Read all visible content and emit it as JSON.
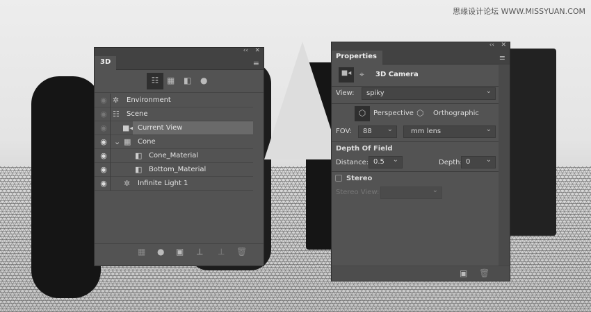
{
  "watermark": "思缘设计论坛 WWW.MISSYUAN.COM",
  "panel3d": {
    "tab": "3D",
    "collapse": "‹‹",
    "close": "✕",
    "layers": [
      {
        "label": "Environment",
        "icon": "environment-icon",
        "visible": false
      },
      {
        "label": "Scene",
        "icon": "scene-icon",
        "visible": false
      },
      {
        "label": "Current View",
        "icon": "camera-icon",
        "visible": false,
        "selected": true
      },
      {
        "label": "Cone",
        "icon": "mesh-icon",
        "visible": true,
        "expanded": true
      },
      {
        "label": "Cone_Material",
        "icon": "material-icon",
        "visible": true
      },
      {
        "label": "Bottom_Material",
        "icon": "material-icon",
        "visible": true
      },
      {
        "label": "Infinite Light 1",
        "icon": "light-icon",
        "visible": true
      }
    ]
  },
  "properties": {
    "tab": "Properties",
    "title": "3D Camera",
    "view_label": "View:",
    "view_value": "spiky",
    "perspective": "Perspective",
    "orthographic": "Orthographic",
    "fov_label": "FOV:",
    "fov_value": "88",
    "fov_unit": "mm lens",
    "dof_heading": "Depth Of Field",
    "distance_label": "Distance:",
    "distance_value": "0.5",
    "depth_label": "Depth:",
    "depth_value": "0",
    "stereo_label": "Stereo",
    "stereo_checked": false,
    "stereo_view_label": "Stereo View:",
    "stereo_view_value": ""
  }
}
